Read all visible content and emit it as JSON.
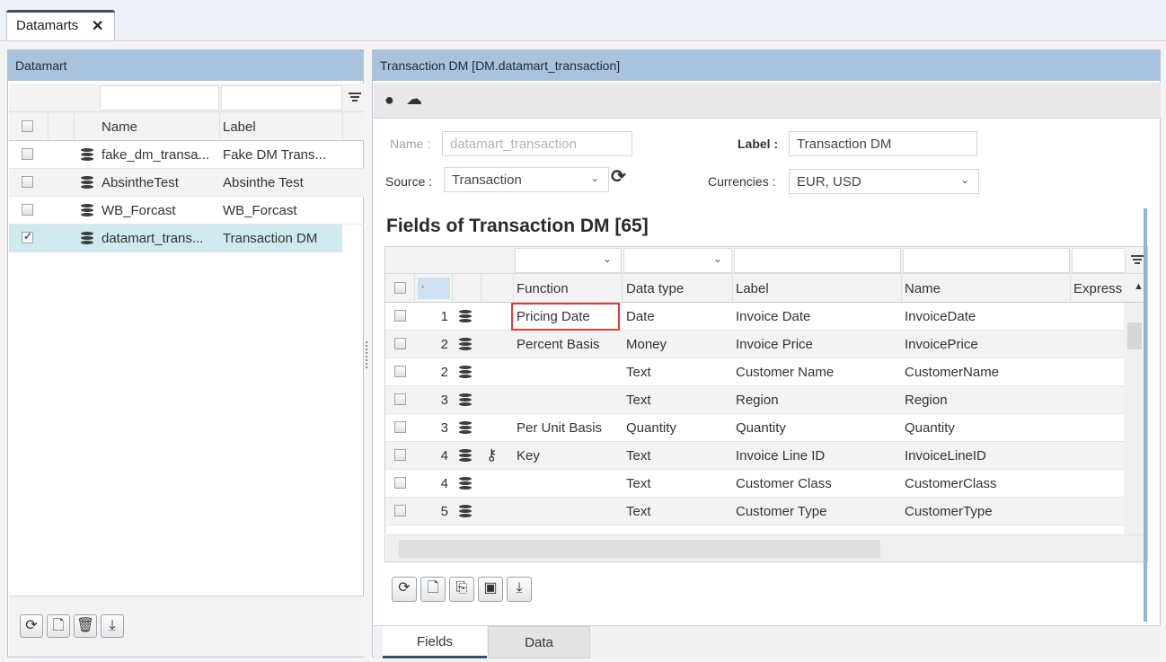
{
  "top_tab": {
    "label": "Datamarts",
    "close": "✕"
  },
  "left": {
    "title": "Datamart",
    "columns": {
      "name": "Name",
      "label": "Label"
    },
    "rows": [
      {
        "name": "fake_dm_transa...",
        "label": "Fake DM Trans...",
        "checked": false
      },
      {
        "name": "AbsintheTest",
        "label": "Absinthe Test",
        "checked": false
      },
      {
        "name": "WB_Forcast",
        "label": "WB_Forcast",
        "checked": false
      },
      {
        "name": "datamart_trans...",
        "label": "Transaction DM",
        "checked": true
      }
    ],
    "footer_buttons": [
      "refresh-icon",
      "add-file-icon",
      "trash-icon",
      "download-icon"
    ]
  },
  "right": {
    "title": "Transaction DM  [DM.datamart_transaction]",
    "toolbar_icons": [
      "settings-db-icon",
      "deploy-icon"
    ],
    "form": {
      "name_label": "Name :",
      "name_value": "datamart_transaction",
      "label_label": "Label :",
      "label_value": "Transaction DM",
      "source_label": "Source :",
      "source_value": "Transaction",
      "currencies_label": "Currencies :",
      "currencies_value": "EUR, USD"
    },
    "fields_title": "Fields of Transaction DM [65]",
    "grid": {
      "sort_marker": ".",
      "columns": {
        "function": "Function",
        "data_type": "Data type",
        "label": "Label",
        "name": "Name",
        "expression": "Express"
      },
      "rows": [
        {
          "num": "1",
          "key": false,
          "function": "Pricing Date",
          "data_type": "Date",
          "label": "Invoice Date",
          "name": "InvoiceDate"
        },
        {
          "num": "2",
          "key": false,
          "function": "Percent Basis",
          "data_type": "Money",
          "label": "Invoice Price",
          "name": "InvoicePrice"
        },
        {
          "num": "2",
          "key": false,
          "function": "",
          "data_type": "Text",
          "label": "Customer Name",
          "name": "CustomerName"
        },
        {
          "num": "3",
          "key": false,
          "function": "",
          "data_type": "Text",
          "label": "Region",
          "name": "Region"
        },
        {
          "num": "3",
          "key": false,
          "function": "Per Unit Basis",
          "data_type": "Quantity",
          "label": "Quantity",
          "name": "Quantity"
        },
        {
          "num": "4",
          "key": true,
          "function": "Key",
          "data_type": "Text",
          "label": "Invoice Line ID",
          "name": "InvoiceLineID"
        },
        {
          "num": "4",
          "key": false,
          "function": "",
          "data_type": "Text",
          "label": "Customer Class",
          "name": "CustomerClass"
        },
        {
          "num": "5",
          "key": false,
          "function": "",
          "data_type": "Text",
          "label": "Customer Type",
          "name": "CustomerType"
        }
      ]
    },
    "footer_buttons": [
      "refresh-icon",
      "add-file-icon",
      "copy-file-icon",
      "save-icon",
      "download-icon"
    ],
    "tabs": {
      "fields": "Fields",
      "data": "Data"
    }
  },
  "colors": {
    "panel_header": "#a9c3dc",
    "selected_row": "#cfe9ee",
    "highlight": "#e23b3b",
    "accent": "#3a4f66"
  }
}
